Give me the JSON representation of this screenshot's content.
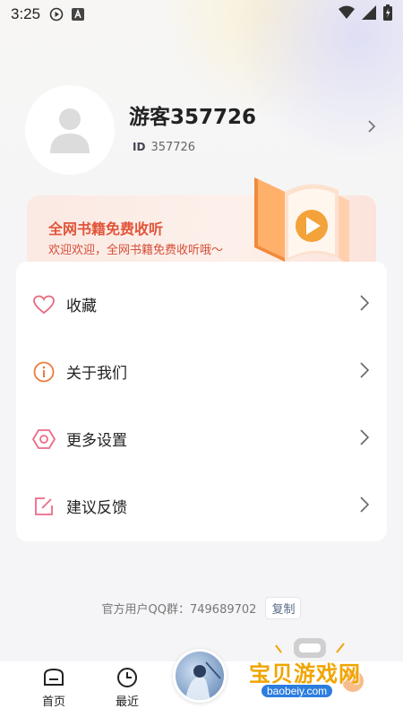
{
  "status_bar": {
    "time": "3:25",
    "icons": [
      "play-circle-icon",
      "a-box-icon",
      "wifi-icon",
      "signal-icon",
      "battery-icon"
    ]
  },
  "profile": {
    "username": "游客357726",
    "id_label": "ID",
    "id_value": "357726"
  },
  "banner": {
    "title": "全网书籍免费收听",
    "subtitle": "欢迎欢迎，全网书籍免费收听哦～"
  },
  "menu": [
    {
      "label": "收藏",
      "icon": "heart-icon"
    },
    {
      "label": "关于我们",
      "icon": "info-icon"
    },
    {
      "label": "更多设置",
      "icon": "settings-icon"
    },
    {
      "label": "建议反馈",
      "icon": "edit-icon"
    }
  ],
  "qq_group": {
    "text": "官方用户QQ群：749689702",
    "copy_label": "复制"
  },
  "bottom_nav": {
    "home": "首页",
    "recent": "最近"
  },
  "colors": {
    "accent": "#e2553a",
    "watermark": "#f0a500"
  }
}
